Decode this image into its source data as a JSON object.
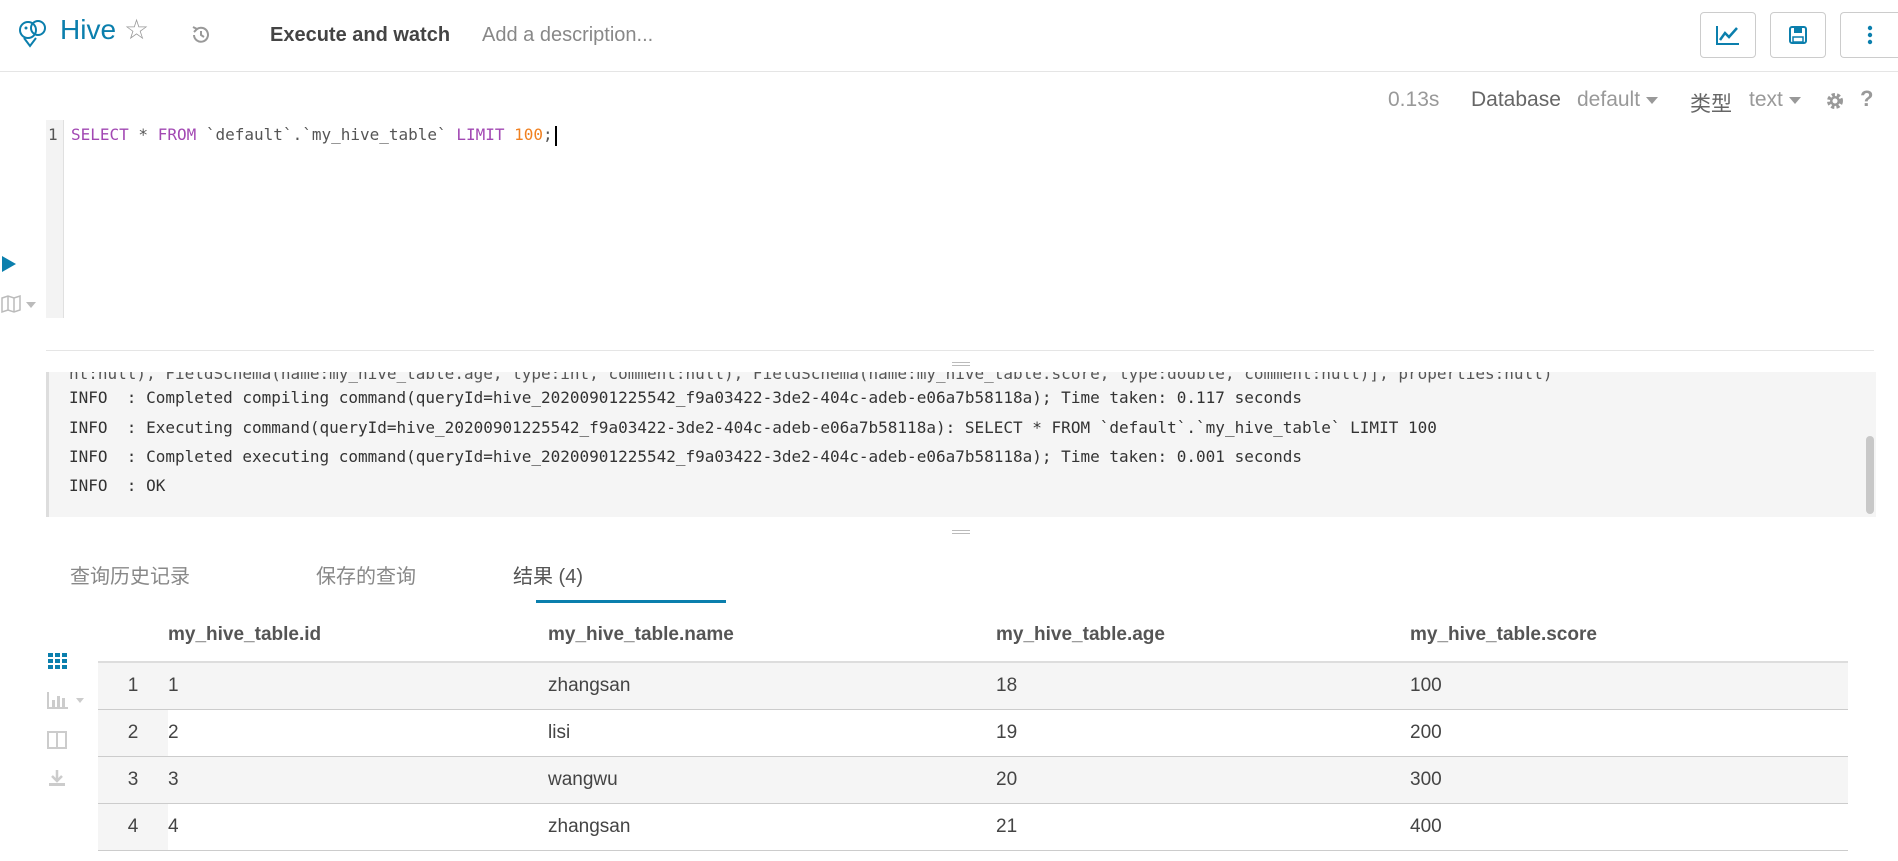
{
  "header": {
    "app_title": "Hive",
    "execute_watch": "Execute and watch",
    "description_placeholder": "Add a description..."
  },
  "editor": {
    "exec_time": "0.13s",
    "database_label": "Database",
    "database_value": "default",
    "type_label": "类型",
    "type_value": "text",
    "help_label": "?",
    "line_number": "1",
    "sql_select": "SELECT",
    "sql_star": " * ",
    "sql_from": "FROM",
    "sql_table": " `default`.`my_hive_table` ",
    "sql_limit": "LIMIT",
    "sql_value": "100",
    "sql_end": ";"
  },
  "log": {
    "lines": [
      "nt:null), FieldSchema(name:my_hive_table.age, type:int, comment:null), FieldSchema(name:my_hive_table.score, type:double, comment:null)], properties:null)",
      "INFO  : Completed compiling command(queryId=hive_20200901225542_f9a03422-3de2-404c-adeb-e06a7b58118a); Time taken: 0.117 seconds",
      "INFO  : Executing command(queryId=hive_20200901225542_f9a03422-3de2-404c-adeb-e06a7b58118a): SELECT * FROM `default`.`my_hive_table` LIMIT 100",
      "INFO  : Completed executing command(queryId=hive_20200901225542_f9a03422-3de2-404c-adeb-e06a7b58118a); Time taken: 0.001 seconds",
      "INFO  : OK"
    ]
  },
  "tabs": [
    {
      "label": "查询历史记录"
    },
    {
      "label": "保存的查询"
    },
    {
      "label": "结果 (4)"
    }
  ],
  "results": {
    "columns": [
      "my_hive_table.id",
      "my_hive_table.name",
      "my_hive_table.age",
      "my_hive_table.score"
    ],
    "rows": [
      {
        "num": "1",
        "id": "1",
        "name": "zhangsan",
        "age": "18",
        "score": "100"
      },
      {
        "num": "2",
        "id": "2",
        "name": "lisi",
        "age": "19",
        "score": "200"
      },
      {
        "num": "3",
        "id": "3",
        "name": "wangwu",
        "age": "20",
        "score": "300"
      },
      {
        "num": "4",
        "id": "4",
        "name": "zhangsan",
        "age": "21",
        "score": "400"
      }
    ]
  },
  "colors": {
    "accent": "#0B7FAD",
    "keyword": "#a248b3",
    "number": "#f08020"
  }
}
